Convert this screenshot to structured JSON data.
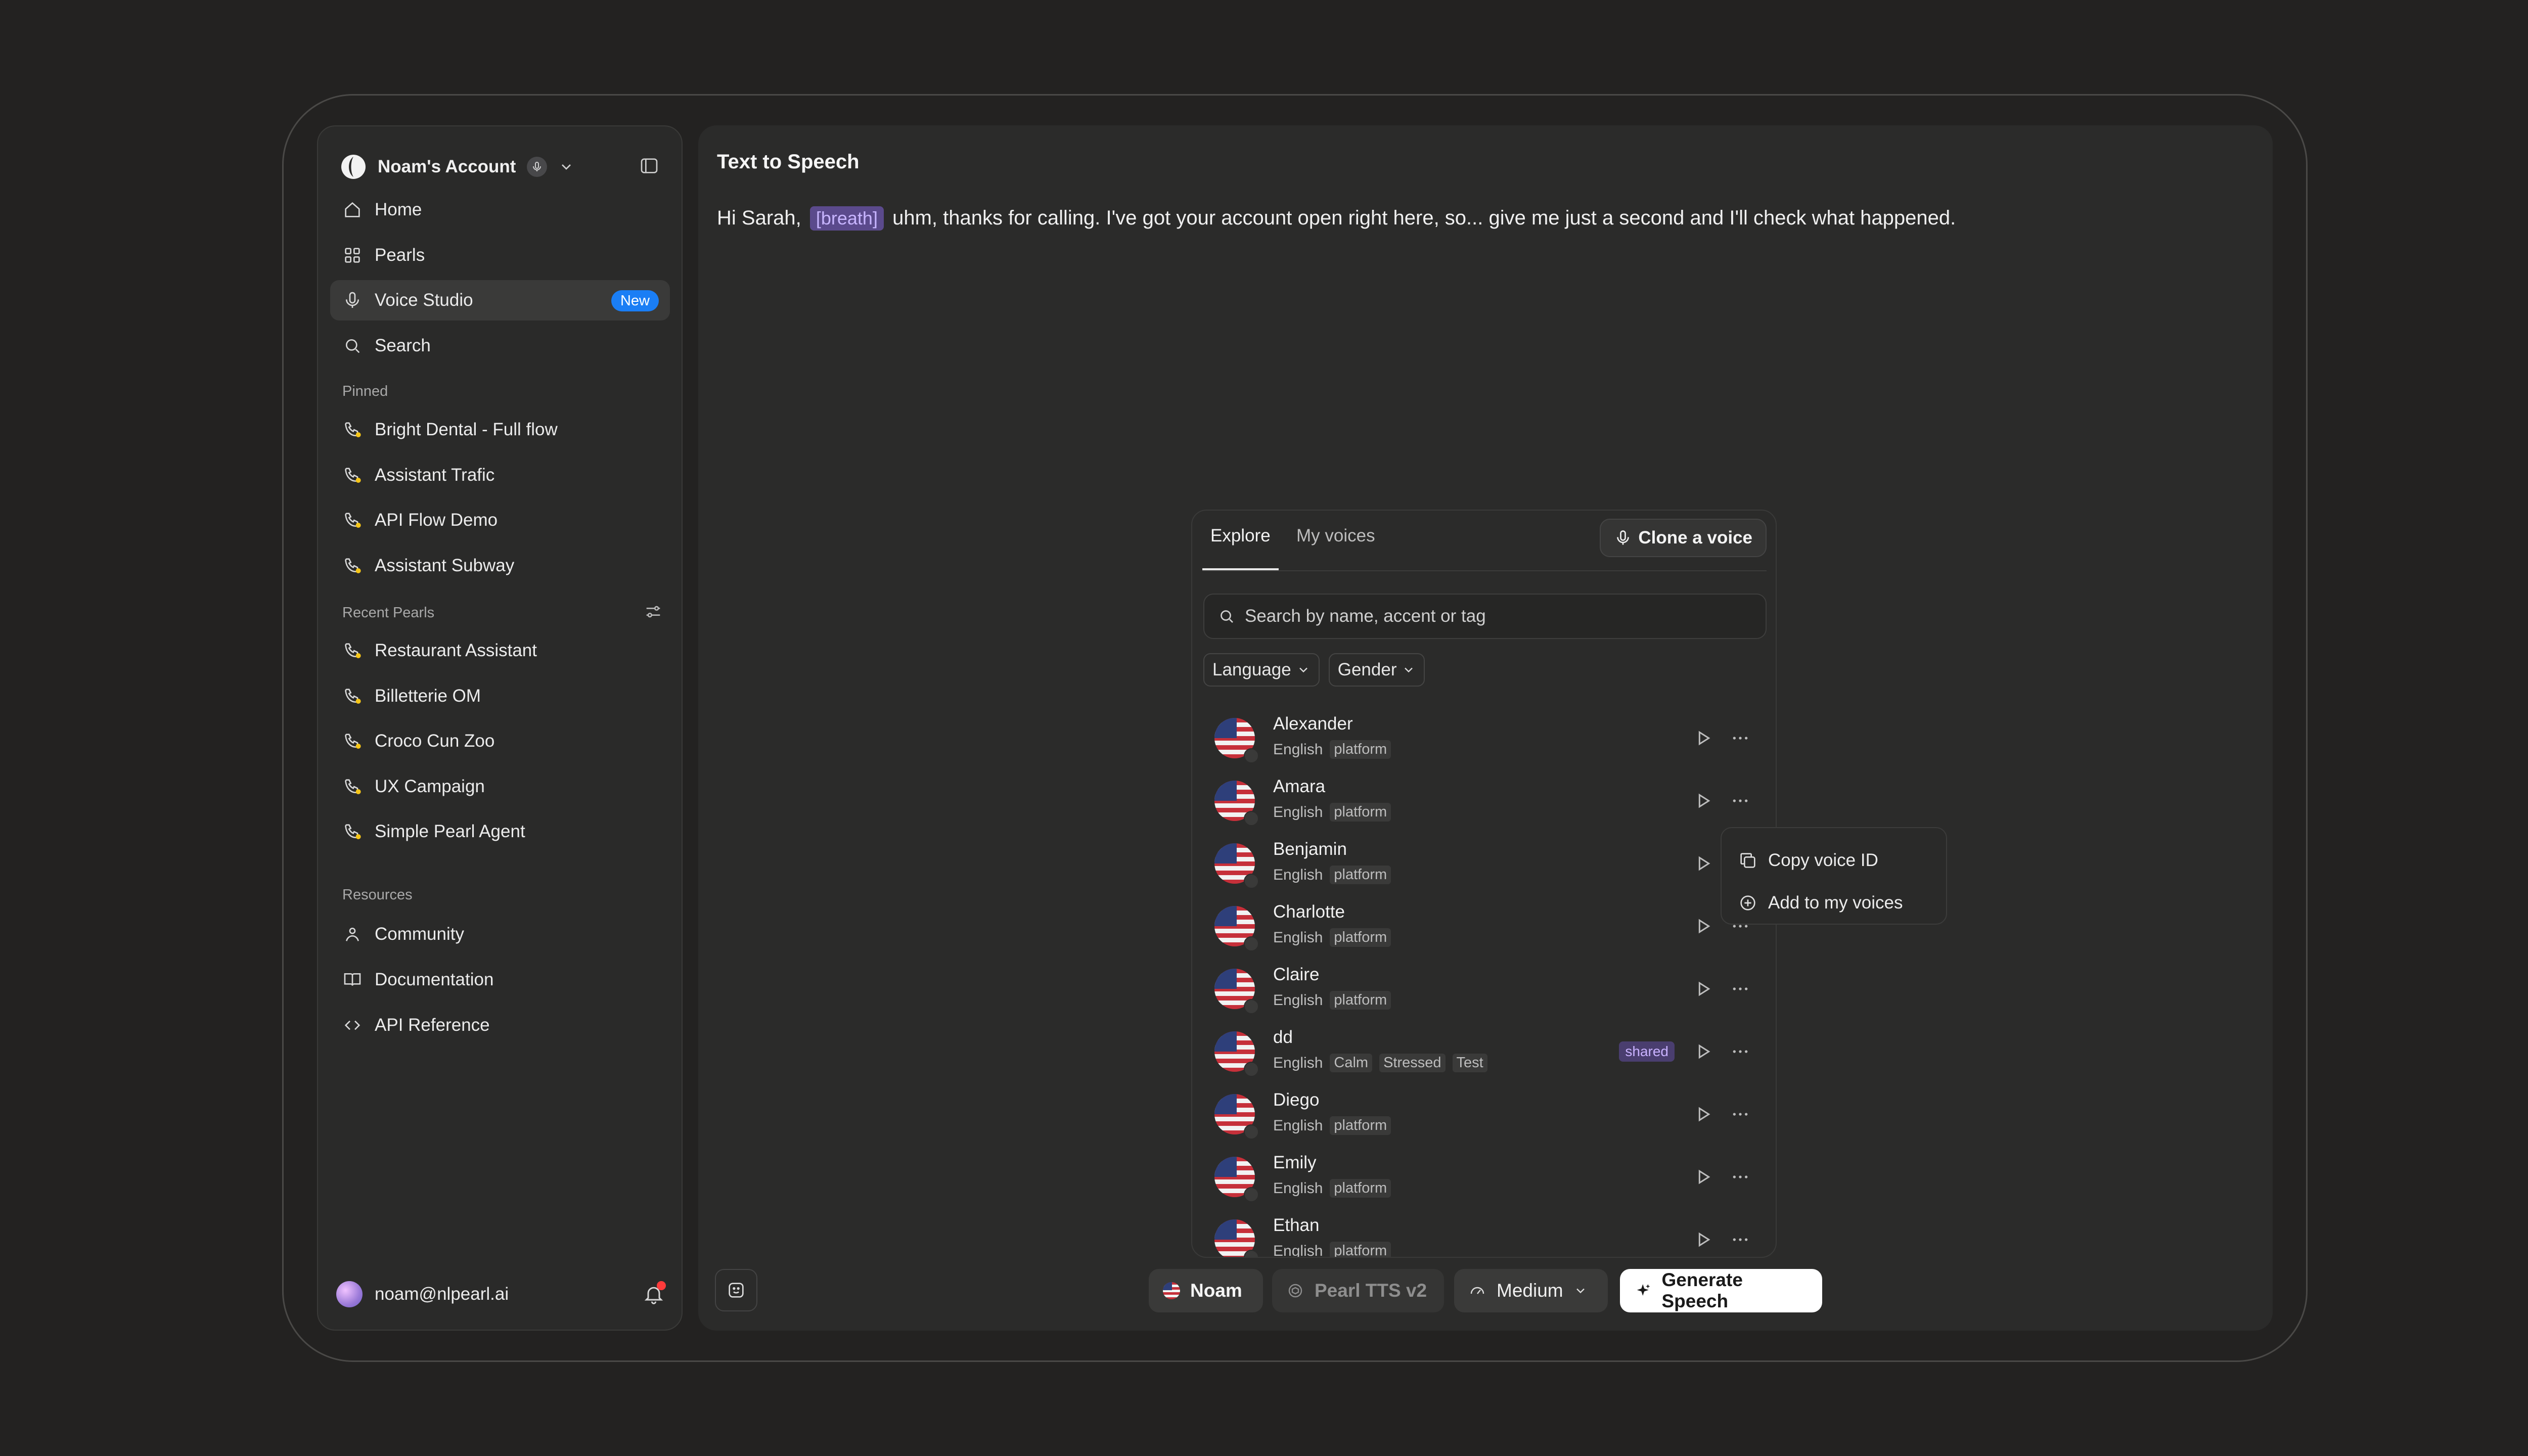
{
  "account": {
    "name": "Noam's Account"
  },
  "nav": {
    "home": "Home",
    "pearls": "Pearls",
    "voice_studio": "Voice Studio",
    "voice_studio_badge": "New",
    "search": "Search"
  },
  "pinned": {
    "label": "Pinned",
    "items": [
      "Bright Dental - Full flow",
      "Assistant Trafic",
      "API Flow Demo",
      "Assistant Subway"
    ]
  },
  "recent": {
    "label": "Recent Pearls",
    "items": [
      "Restaurant Assistant",
      "Billetterie OM",
      "Croco Cun Zoo",
      "UX Campaign",
      "Simple Pearl Agent"
    ]
  },
  "resources": {
    "label": "Resources",
    "community": "Community",
    "documentation": "Documentation",
    "api_reference": "API Reference"
  },
  "user": {
    "email": "noam@nlpearl.ai"
  },
  "main": {
    "title": "Text to Speech",
    "text_before": "Hi Sarah,",
    "tag": "[breath]",
    "text_after": "uhm, thanks for calling. I've got your account open right here, so... give me just a second and I'll check what happened."
  },
  "picker": {
    "tab_explore": "Explore",
    "tab_my_voices": "My voices",
    "clone": "Clone a voice",
    "search_placeholder": "Search by name, accent or tag",
    "filter_language": "Language",
    "filter_gender": "Gender",
    "voices": [
      {
        "name": "Alexander",
        "lang": "English",
        "tags": [
          "platform"
        ]
      },
      {
        "name": "Amara",
        "lang": "English",
        "tags": [
          "platform"
        ]
      },
      {
        "name": "Benjamin",
        "lang": "English",
        "tags": [
          "platform"
        ]
      },
      {
        "name": "Charlotte",
        "lang": "English",
        "tags": [
          "platform"
        ]
      },
      {
        "name": "Claire",
        "lang": "English",
        "tags": [
          "platform"
        ]
      },
      {
        "name": "dd",
        "lang": "English",
        "tags": [
          "Calm",
          "Stressed",
          "Test"
        ],
        "shared": "shared"
      },
      {
        "name": "Diego",
        "lang": "English",
        "tags": [
          "platform"
        ]
      },
      {
        "name": "Emily",
        "lang": "English",
        "tags": [
          "platform"
        ]
      },
      {
        "name": "Ethan",
        "lang": "English",
        "tags": [
          "platform"
        ]
      }
    ]
  },
  "context_menu": {
    "copy_id": "Copy voice ID",
    "add_to_my_voices": "Add to my voices"
  },
  "bottom": {
    "voice": "Noam",
    "model": "Pearl TTS v2",
    "speed": "Medium",
    "generate": "Generate Speech"
  },
  "colors": {
    "accent_blue": "#1a7ef5",
    "tag_purple": "#5b4a8c",
    "notification_red": "#ff3b3b"
  }
}
